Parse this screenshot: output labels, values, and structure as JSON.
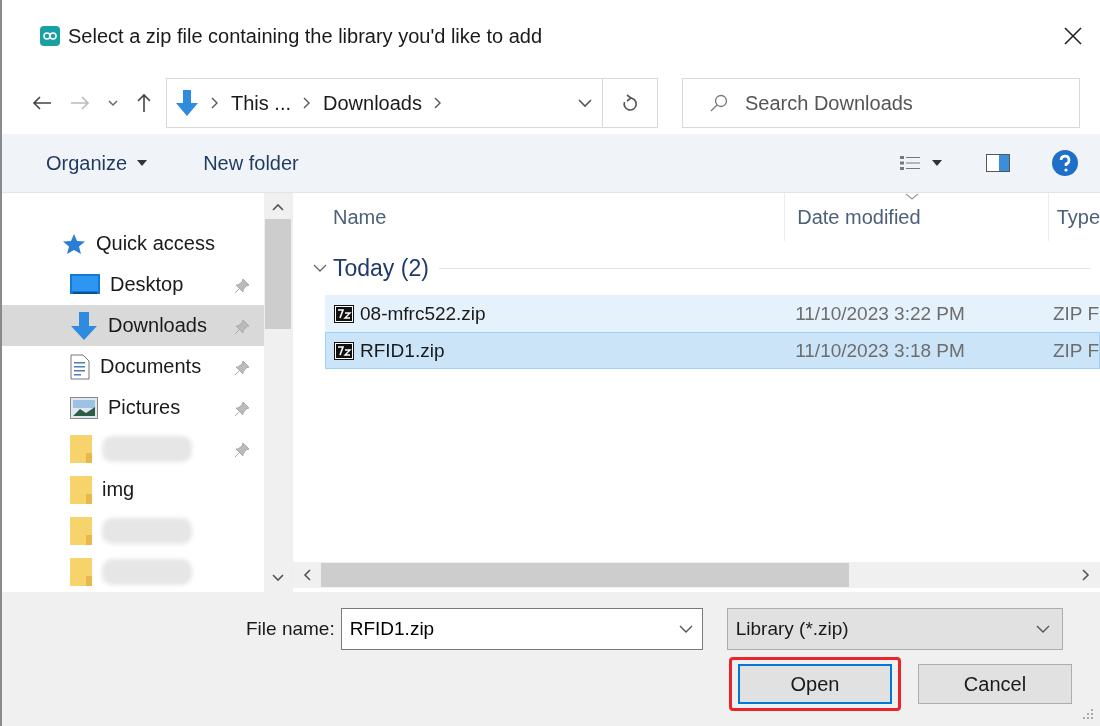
{
  "window": {
    "title": "Select a zip file containing the library you'd like to add"
  },
  "address_bar": {
    "segments": [
      "This ...",
      "Downloads"
    ]
  },
  "search": {
    "placeholder": "Search Downloads"
  },
  "toolbar": {
    "organize": "Organize",
    "new_folder": "New folder"
  },
  "sidebar": {
    "items": [
      {
        "kind": "quick",
        "label": "Quick access",
        "pinned": false,
        "selected": false
      },
      {
        "kind": "desktop",
        "label": "Desktop",
        "pinned": true,
        "selected": false
      },
      {
        "kind": "download",
        "label": "Downloads",
        "pinned": true,
        "selected": true
      },
      {
        "kind": "documents",
        "label": "Documents",
        "pinned": true,
        "selected": false
      },
      {
        "kind": "pictures",
        "label": "Pictures",
        "pinned": true,
        "selected": false
      },
      {
        "kind": "blurred",
        "pinned": true,
        "selected": false
      },
      {
        "kind": "folder",
        "label": "img",
        "pinned": false,
        "selected": false
      },
      {
        "kind": "blurred",
        "pinned": false,
        "selected": false
      },
      {
        "kind": "blurred",
        "pinned": false,
        "selected": false
      }
    ]
  },
  "file_list": {
    "columns": [
      "Name",
      "Date modified",
      "Type"
    ],
    "groups": [
      {
        "label": "Today (2)",
        "expanded": true,
        "rows": [
          {
            "name": "08-mfrc522.zip",
            "date": "11/10/2023 3:22 PM",
            "type": "ZIP F",
            "selected": false,
            "hovered": true
          },
          {
            "name": "RFID1.zip",
            "date": "11/10/2023 3:18 PM",
            "type": "ZIP F",
            "selected": true,
            "hovered": false
          }
        ]
      }
    ]
  },
  "file_name": {
    "label": "File name:",
    "value": "RFID1.zip"
  },
  "file_type": {
    "value": "Library (*.zip)"
  },
  "buttons": [
    {
      "label": "Open",
      "default": true,
      "annotated": true
    },
    {
      "label": "Cancel",
      "default": false,
      "annotated": false
    }
  ]
}
